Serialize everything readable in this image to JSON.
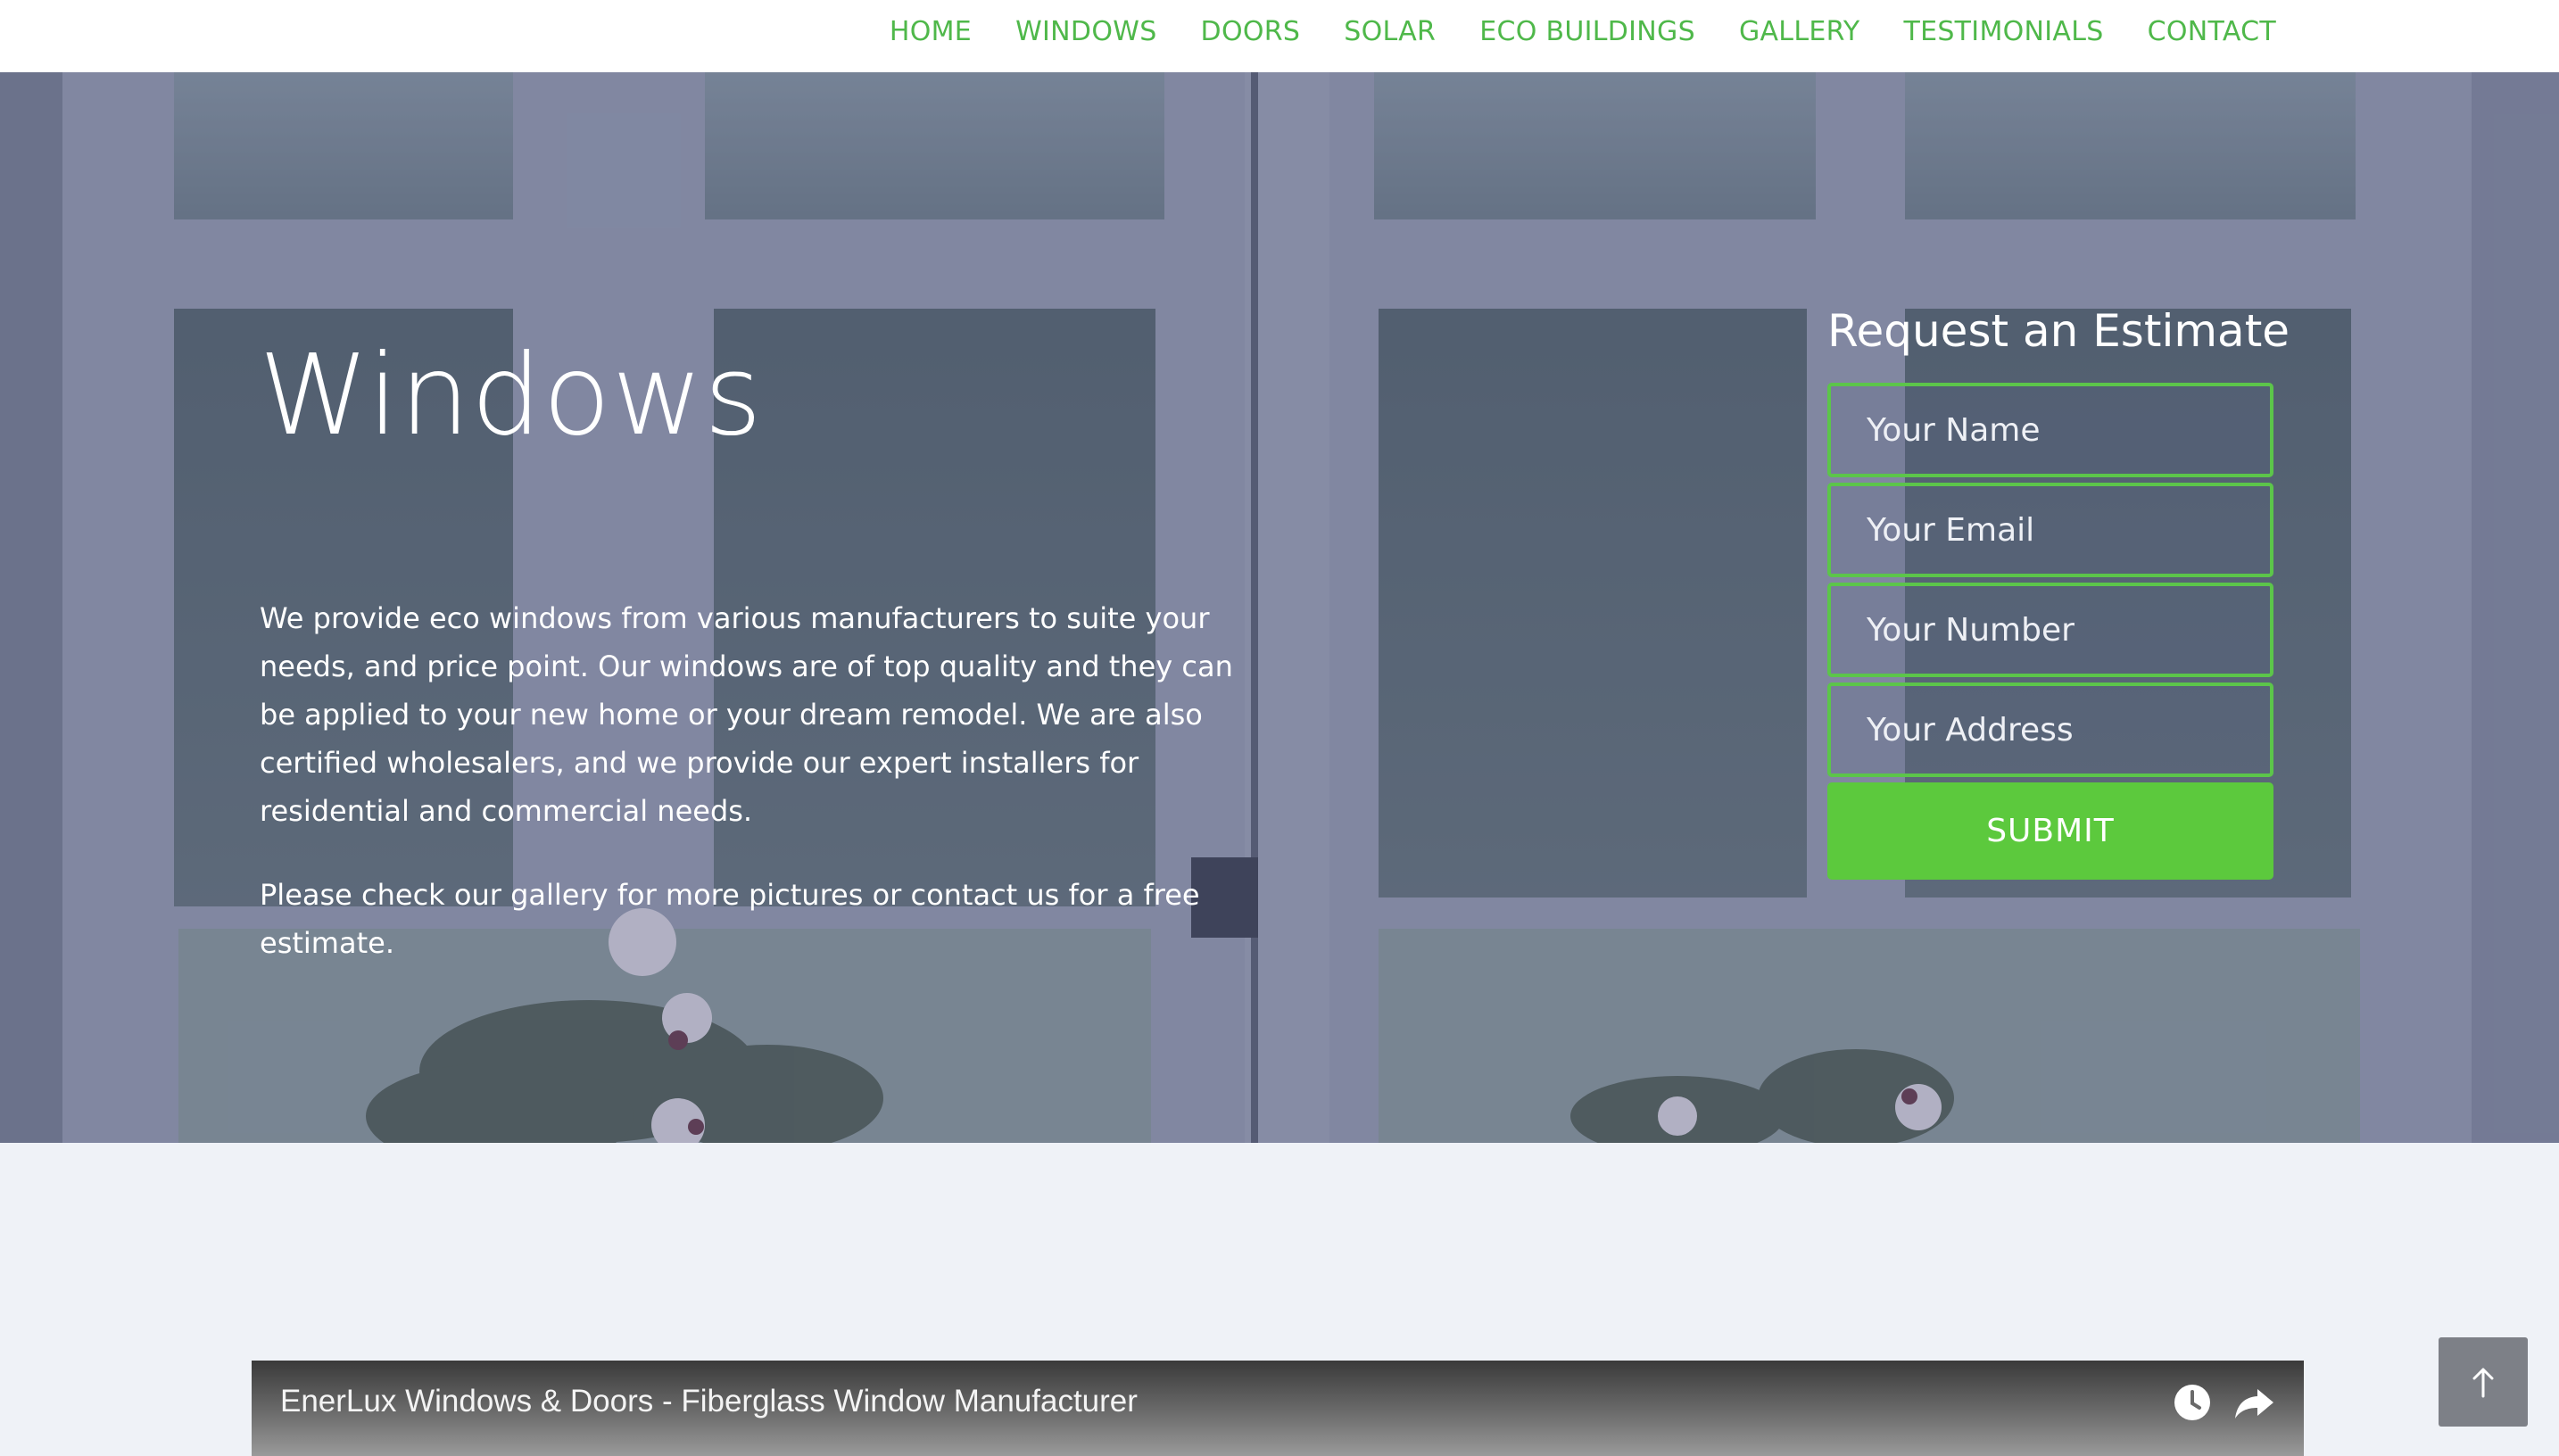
{
  "nav": {
    "items": [
      {
        "label": "HOME"
      },
      {
        "label": "WINDOWS"
      },
      {
        "label": "DOORS"
      },
      {
        "label": "SOLAR"
      },
      {
        "label": "ECO BUILDINGS"
      },
      {
        "label": "GALLERY"
      },
      {
        "label": "TESTIMONIALS"
      },
      {
        "label": "CONTACT"
      }
    ]
  },
  "hero": {
    "title": "Windows",
    "paragraphs": [
      "We provide eco windows from various manufacturers to suite your needs, and price point. Our windows are of top quality and they can be applied to your new home or your dream remodel. We are also certified wholesalers, and we provide our expert installers for residential and commercial needs.",
      "Please check our gallery for more pictures or contact us for a free estimate."
    ]
  },
  "estimate": {
    "title": "Request an Estimate",
    "name_placeholder": "Your Name",
    "email_placeholder": "Your Email",
    "number_placeholder": "Your Number",
    "address_placeholder": "Your Address",
    "submit_label": "SUBMIT"
  },
  "video": {
    "title": "EnerLux Windows & Doors - Fiberglass Window Manufacturer",
    "watch_later_icon": "clock-icon",
    "share_icon": "share-arrow-icon"
  },
  "back_to_top": {
    "icon": "arrow-up-icon"
  },
  "colors": {
    "accent": "#5cc93d",
    "nav_link": "#4fb84a",
    "page_background": "#eff2f7",
    "back_to_top": "#7d8087"
  }
}
